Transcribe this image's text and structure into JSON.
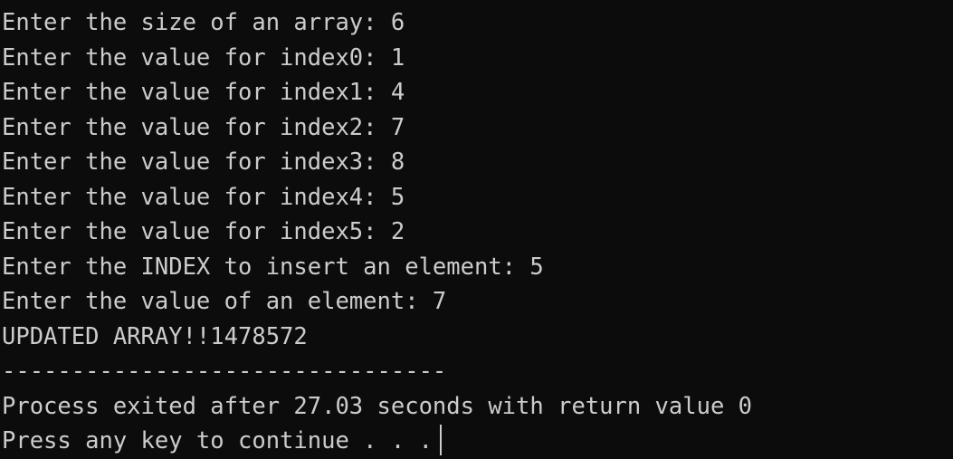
{
  "console": {
    "lines": [
      "Enter the size of an array: 6",
      "Enter the value for index0: 1",
      "Enter the value for index1: 4",
      "Enter the value for index2: 7",
      "Enter the value for index3: 8",
      "Enter the value for index4: 5",
      "Enter the value for index5: 2",
      "Enter the INDEX to insert an element: 5",
      "Enter the value of an element: 7",
      "UPDATED ARRAY!!1478572",
      "--------------------------------",
      "Process exited after 27.03 seconds with return value 0",
      "Press any key to continue . . ."
    ]
  },
  "colors": {
    "background": "#0c0c0c",
    "text": "#cccccc"
  }
}
